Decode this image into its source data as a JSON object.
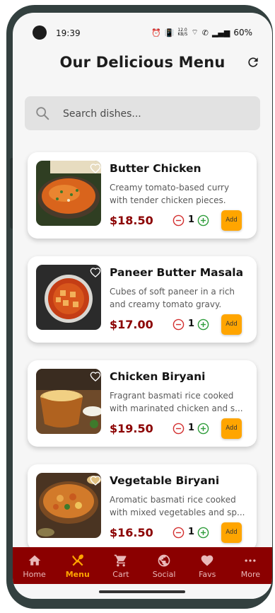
{
  "status": {
    "time": "19:39",
    "net_speed": "12.0 KB/S",
    "battery": "60%"
  },
  "header": {
    "title": "Our Delicious Menu"
  },
  "search": {
    "placeholder": "Search dishes..."
  },
  "menu": [
    {
      "name": "Butter Chicken",
      "desc_line1": "Creamy tomato-based curry",
      "desc_line2": "with tender chicken pieces.",
      "price": "$18.50",
      "qty": "1",
      "add_label": "Add"
    },
    {
      "name": "Paneer Butter Masala",
      "desc_line1": "Cubes of soft paneer in a rich",
      "desc_line2": "and creamy tomato gravy.",
      "price": "$17.00",
      "qty": "1",
      "add_label": "Add"
    },
    {
      "name": "Chicken Biryani",
      "desc_line1": "Fragrant basmati rice cooked",
      "desc_line2": "with marinated chicken and s...",
      "price": "$19.50",
      "qty": "1",
      "add_label": "Add"
    },
    {
      "name": "Vegetable Biryani",
      "desc_line1": "Aromatic basmati rice cooked",
      "desc_line2": "with mixed vegetables and sp...",
      "price": "$16.50",
      "qty": "1",
      "add_label": "Add"
    }
  ],
  "nav": {
    "items": [
      {
        "label": "Home",
        "icon": "home-icon"
      },
      {
        "label": "Menu",
        "icon": "fork-knife-icon",
        "active": true
      },
      {
        "label": "Cart",
        "icon": "cart-icon"
      },
      {
        "label": "Social",
        "icon": "globe-icon"
      },
      {
        "label": "Favs",
        "icon": "heart-icon"
      },
      {
        "label": "More",
        "icon": "more-icon"
      }
    ]
  },
  "colors": {
    "brand": "#8b0000",
    "accent": "#ffa500",
    "background": "#f6f6f6"
  }
}
